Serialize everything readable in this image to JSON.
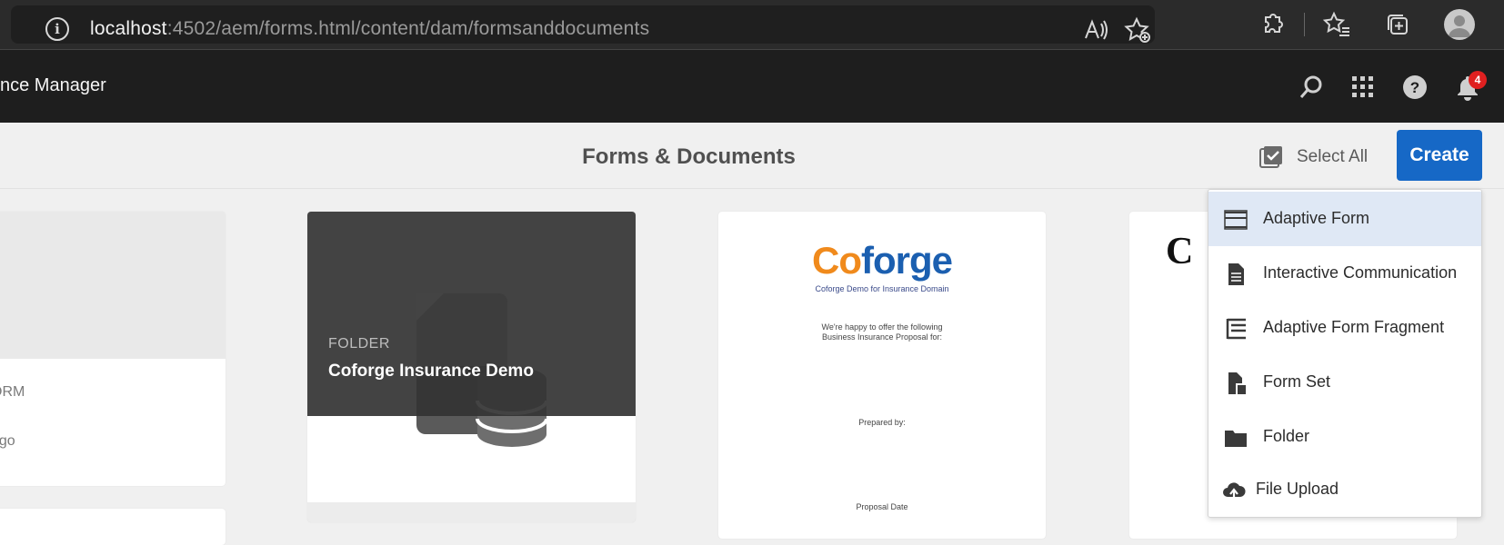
{
  "browser": {
    "url_host": "localhost",
    "url_path": ":4502/aem/forms.html/content/dam/formsanddocuments",
    "icons": [
      "info-icon",
      "read-aloud-icon",
      "add-favorite-icon",
      "extensions-icon",
      "favorites-icon",
      "collections-icon",
      "profile-avatar"
    ]
  },
  "header": {
    "title": "nce Manager",
    "notification_count": "4",
    "icons": [
      "search-icon",
      "apps-grid-icon",
      "help-icon",
      "bell-icon"
    ]
  },
  "action_bar": {
    "title": "Forms & Documents",
    "select_all_label": "Select All",
    "create_label": "Create"
  },
  "cards": {
    "card1": {
      "type": "ORM",
      "meta": "ago"
    },
    "card2": {
      "type": "FOLDER",
      "name": "Coforge Insurance Demo"
    },
    "card3": {
      "logo_first": "Co",
      "logo_rest": "forge",
      "subtitle": "Coforge Demo for Insurance Domain",
      "line1": "We're happy to offer the following",
      "line2": "Business Insurance Proposal for:",
      "prepared_by": "Prepared by:",
      "proposal_date": "Proposal Date"
    },
    "card4": {
      "logo_text": "C"
    }
  },
  "create_menu": {
    "items": [
      {
        "label": "Adaptive Form",
        "icon": "adaptive-form-icon"
      },
      {
        "label": "Interactive Communication",
        "icon": "document-icon"
      },
      {
        "label": "Adaptive Form Fragment",
        "icon": "form-fragment-icon"
      },
      {
        "label": "Form Set",
        "icon": "form-set-icon"
      },
      {
        "label": "Folder",
        "icon": "folder-icon"
      },
      {
        "label": "File Upload",
        "icon": "cloud-upload-icon"
      }
    ]
  },
  "colors": {
    "accent": "#1668c6",
    "header_bg": "#1e1e1e",
    "menu_active": "#dfe8f5",
    "badge": "#e02020",
    "logo_orange": "#f08a1c",
    "logo_blue": "#1b5fb0"
  }
}
